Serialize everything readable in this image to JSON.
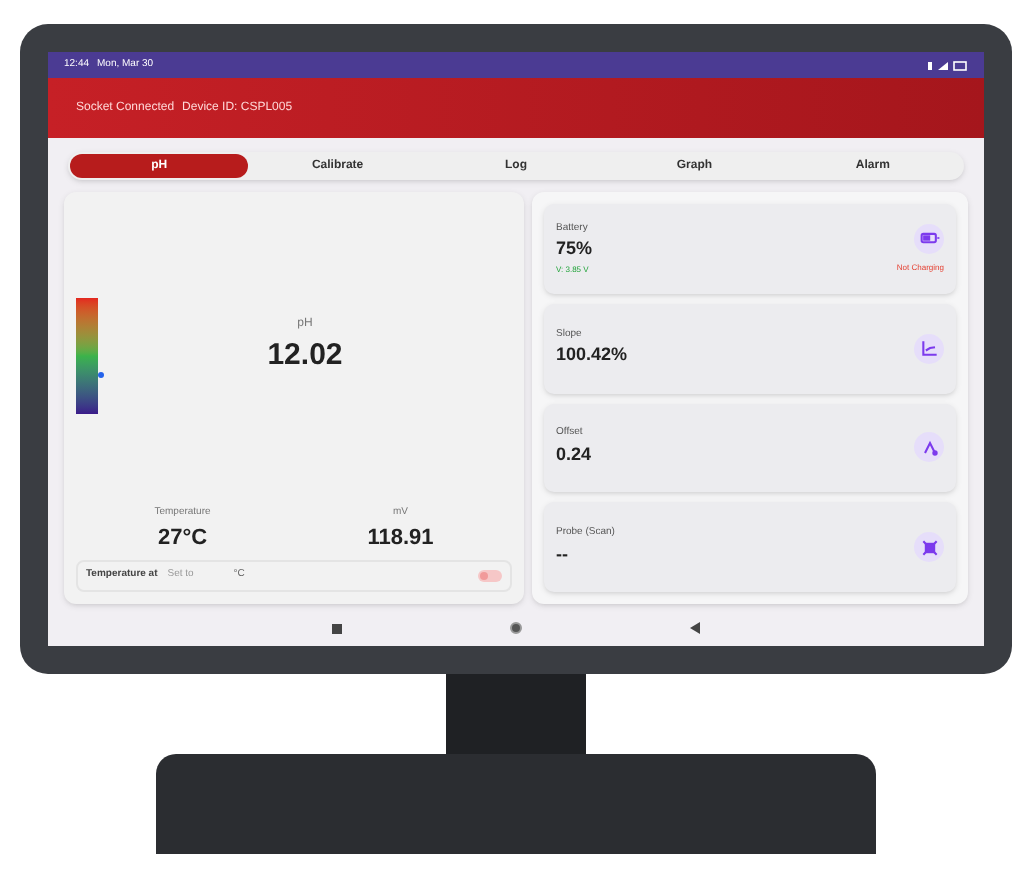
{
  "status_bar": {
    "time": "12:44",
    "date": "Mon, Mar 30"
  },
  "header": {
    "status": "Socket Connected",
    "device": "Device ID: CSPL005"
  },
  "tabs": [
    {
      "label": "pH",
      "selected": true
    },
    {
      "label": "Calibrate",
      "selected": false
    },
    {
      "label": "Log",
      "selected": false
    },
    {
      "label": "Graph",
      "selected": false
    },
    {
      "label": "Alarm",
      "selected": false
    }
  ],
  "reading": {
    "label": "pH",
    "value": "12.02",
    "scale": {
      "level": 0.3
    }
  },
  "secondary": [
    {
      "label": "Temperature",
      "value": "27°C"
    },
    {
      "label": "mV",
      "value": "118.91"
    }
  ],
  "temperature_setting": {
    "label": "Temperature at",
    "placeholder": "Set to",
    "unit": "°C"
  },
  "cards": [
    {
      "label": "Battery",
      "value": "75%",
      "kind": "battery",
      "note": "V: 3.85 V",
      "state": "Not Charging"
    },
    {
      "label": "Slope",
      "value": "100.42%",
      "kind": "slope"
    },
    {
      "label": "Offset",
      "value": "0.24",
      "kind": "offset"
    },
    {
      "label": "Probe (Scan)",
      "value": "--",
      "kind": "probe"
    }
  ]
}
